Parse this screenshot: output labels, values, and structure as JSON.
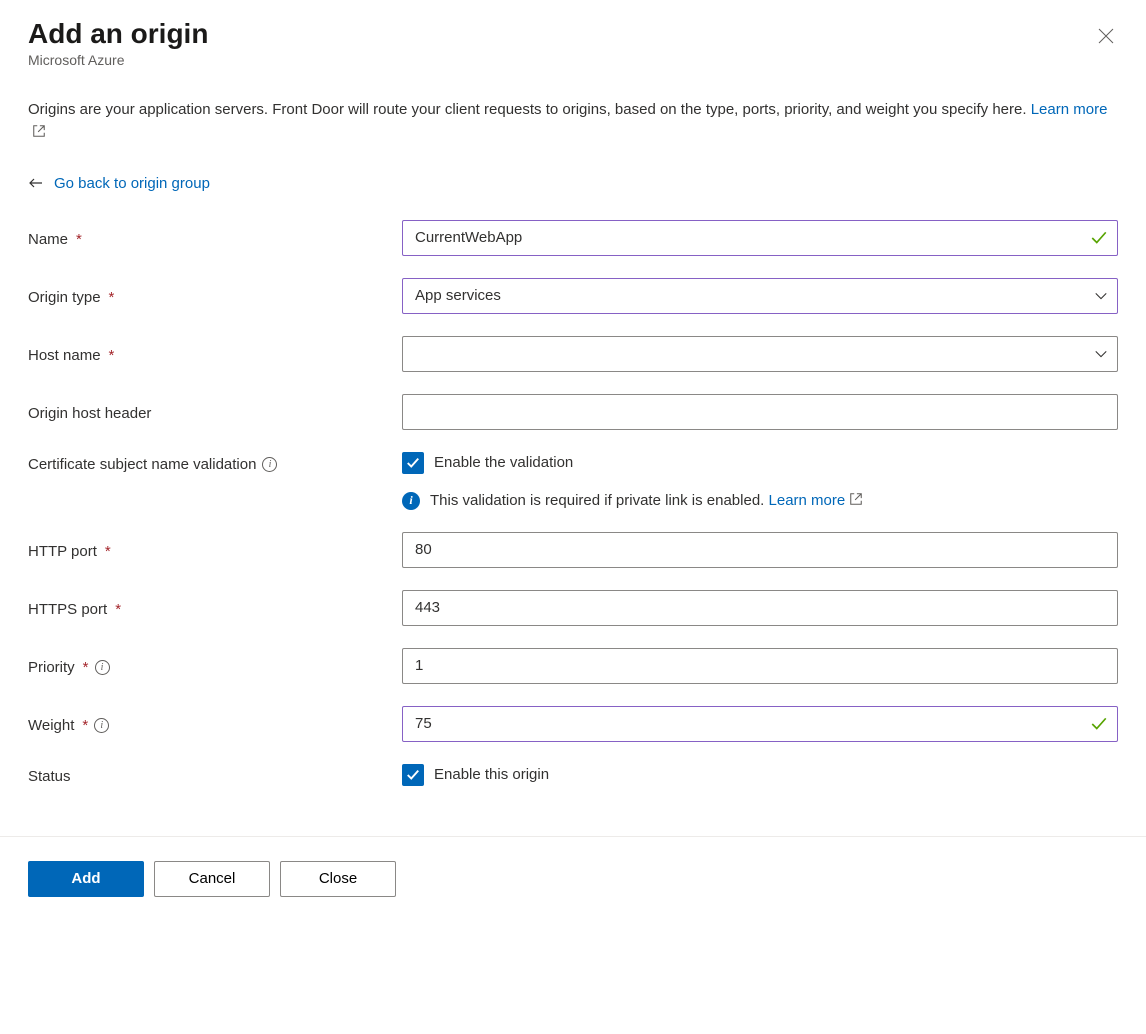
{
  "header": {
    "title": "Add an origin",
    "subtitle": "Microsoft Azure"
  },
  "intro": {
    "text": "Origins are your application servers. Front Door will route your client requests to origins, based on the type, ports, priority, and weight you specify here. ",
    "learn_more": "Learn more"
  },
  "back_link": "Go back to origin group",
  "fields": {
    "name": {
      "label": "Name",
      "value": "CurrentWebApp"
    },
    "origin_type": {
      "label": "Origin type",
      "value": "App services"
    },
    "host_name": {
      "label": "Host name",
      "value": ""
    },
    "host_header": {
      "label": "Origin host header",
      "value": ""
    },
    "cert_validation": {
      "label": "Certificate subject name validation",
      "checkbox_label": "Enable the validation",
      "info_text": "This validation is required if private link is enabled. ",
      "info_learn_more": "Learn more"
    },
    "http_port": {
      "label": "HTTP port",
      "value": "80"
    },
    "https_port": {
      "label": "HTTPS port",
      "value": "443"
    },
    "priority": {
      "label": "Priority",
      "value": "1"
    },
    "weight": {
      "label": "Weight",
      "value": "75"
    },
    "status": {
      "label": "Status",
      "checkbox_label": "Enable this origin"
    }
  },
  "footer": {
    "add": "Add",
    "cancel": "Cancel",
    "close": "Close"
  }
}
